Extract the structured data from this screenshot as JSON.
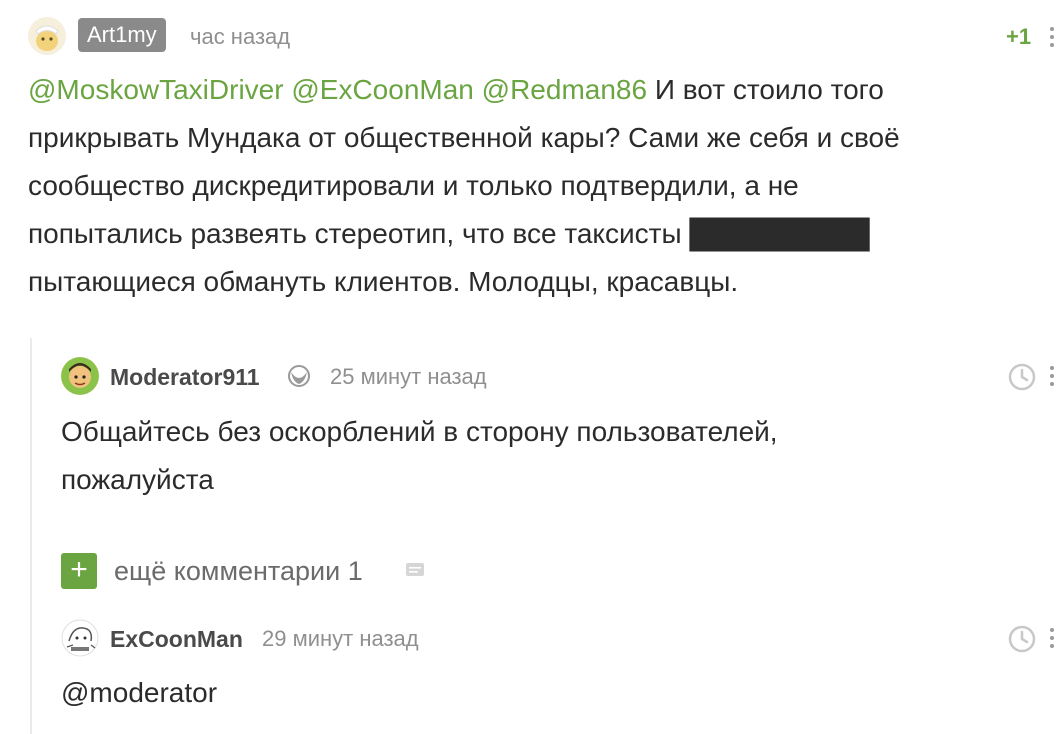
{
  "comment1": {
    "author": "Art1my",
    "time": "час назад",
    "rating": "+1",
    "mentions": [
      "@MoskowTaxiDriver",
      "@ExCoonMan",
      "@Redman86"
    ],
    "line1_rest": "И вот стоило того",
    "line2": "прикрывать Мундака от общественной кары? Сами же себя и своё",
    "line3": "сообщество дискредитировали и только подтвердили, а не",
    "line4": "попытались развеять стереотип, что все таксисты",
    "censored": "██████████",
    "line5": "пытающиеся обмануть клиентов. Молодцы, красавцы."
  },
  "comment2": {
    "author": "Moderator911",
    "time": "25 минут назад",
    "line1": "Общайтесь без оскорблений в сторону пользователей,",
    "line2": "пожалуйста"
  },
  "more_comments": {
    "plus": "+",
    "label": "ещё комментарии 1"
  },
  "comment3": {
    "author": "ExCoonMan",
    "time": "29 минут назад",
    "text": "@moderator"
  },
  "colors": {
    "accent": "#6aa541",
    "badge": "#8a8a8a"
  }
}
